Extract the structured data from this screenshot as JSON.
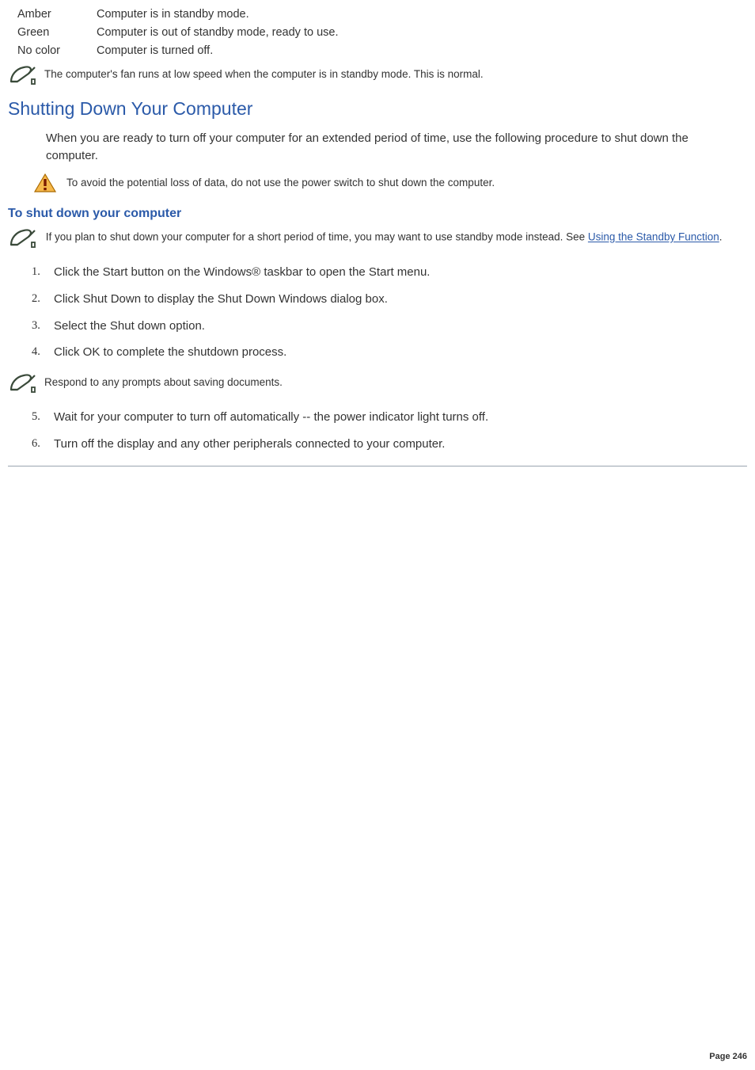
{
  "led": {
    "rows": [
      {
        "color": "Amber",
        "desc": "Computer is in standby mode."
      },
      {
        "color": "Green",
        "desc": "Computer is out of standby mode, ready to use."
      },
      {
        "color": "No color",
        "desc": "Computer is turned off."
      }
    ]
  },
  "notes": {
    "fan": "The computer's fan runs at low speed when the computer is in standby mode. This is normal.",
    "shutdown_short_pre": "If you plan to shut down your computer for a short period of time, you may want to use standby mode instead. See ",
    "shutdown_short_link": "Using the Standby Function",
    "shutdown_short_post": ".",
    "respond_prompts": "Respond to any prompts about saving documents."
  },
  "headings": {
    "shutdown": "Shutting Down Your Computer",
    "to_shutdown": "To shut down your computer"
  },
  "paras": {
    "shutdown_intro": "When you are ready to turn off your computer for an extended period of time, use the following procedure to shut down the computer."
  },
  "warnings": {
    "avoid_switch": "To avoid the potential loss of data, do not use the power switch to shut down the computer."
  },
  "steps": [
    "Click the Start button on the Windows® taskbar to open the Start menu.",
    "Click Shut Down to display the Shut Down Windows dialog box.",
    "Select the Shut down option.",
    "Click OK to complete the shutdown process.",
    "Wait for your computer to turn off automatically -- the power indicator light turns off.",
    "Turn off the display and any other peripherals connected to your computer."
  ],
  "page_label": "Page 246"
}
